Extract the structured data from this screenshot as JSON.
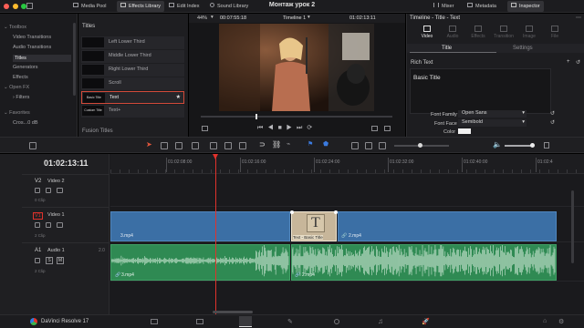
{
  "window": {
    "dots": [
      "#ff5f57",
      "#febc2e",
      "#28c840"
    ]
  },
  "toolbar": {
    "media_pool": "Media Pool",
    "effects_library": "Effects Library",
    "edit_index": "Edit Index",
    "sound_library": "Sound Library",
    "project_title": "Монтаж урок 2",
    "mixer": "Mixer",
    "metadata": "Metadata",
    "inspector": "Inspector"
  },
  "viewer_bar": {
    "zoom": "44%",
    "source_tc": "00:07:55:18",
    "timeline_name": "Timeline 1",
    "record_tc": "01:02:13:11"
  },
  "effects_tree": {
    "items": [
      {
        "label": "Toolbox",
        "level": 0
      },
      {
        "label": "Video Transitions",
        "level": 1
      },
      {
        "label": "Audio Transitions",
        "level": 1
      },
      {
        "label": "Titles",
        "level": 1,
        "selected": true
      },
      {
        "label": "Generators",
        "level": 1
      },
      {
        "label": "Effects",
        "level": 1
      },
      {
        "label": "Open FX",
        "level": 0
      },
      {
        "label": "Filters",
        "level": 1
      },
      {
        "label": "Favorites",
        "level": 0
      },
      {
        "label": "Cros...0 dB",
        "level": 1
      }
    ]
  },
  "titles_panel": {
    "header": "Titles",
    "items": [
      {
        "thumb": "",
        "label": "Left Lower Third"
      },
      {
        "thumb": "",
        "label": "Middle Lower Third"
      },
      {
        "thumb": "",
        "label": "Right Lower Third"
      },
      {
        "thumb": "",
        "label": "Scroll"
      },
      {
        "thumb": "Basic Title",
        "label": "Text",
        "selected": true
      },
      {
        "thumb": "Custom Title",
        "label": "Text+"
      }
    ],
    "fusion_header": "Fusion Titles"
  },
  "inspector": {
    "header": "Timeline - Title - Text",
    "tabs": [
      "Video",
      "Audio",
      "Effects",
      "Transition",
      "Image",
      "File"
    ],
    "subtabs": [
      "Title",
      "Settings"
    ],
    "section": "Rich Text",
    "text_value": "Basic Title",
    "font_family_label": "Font Family",
    "font_family_value": "Open Sans",
    "font_face_label": "Font Face",
    "font_face_value": "Semibold",
    "color_label": "Color"
  },
  "timeline": {
    "timecode": "01:02:13:11",
    "ruler": [
      "01:02:08:00",
      "01:02:16:00",
      "01:02:24:00",
      "01:02:32:00",
      "01:02:40:00",
      "01:02:4"
    ],
    "tracks": {
      "v2": {
        "id": "V2",
        "name": "Video 2",
        "clips": "0 Clip"
      },
      "v1": {
        "id": "V1",
        "name": "Video 1",
        "clips": "2 Clip"
      },
      "a1": {
        "id": "A1",
        "name": "Audio 1",
        "level": "2.0",
        "clips": "2 Clip"
      }
    },
    "clips": {
      "video_a": "3.mp4",
      "title": "Text - Basic Title",
      "video_b": "2.mp4",
      "audio_a": "3.mp4",
      "audio_b": "2.mp4",
      "title_glyph": "T"
    }
  },
  "bottom": {
    "app_name": "DaVinci Resolve 17"
  },
  "colors": {
    "video_clip": "#3b6fa5",
    "audio_clip": "#2f8a53",
    "title_clip": "#c7b69a",
    "playhead": "#e0322c",
    "accent": "#d6543a"
  }
}
